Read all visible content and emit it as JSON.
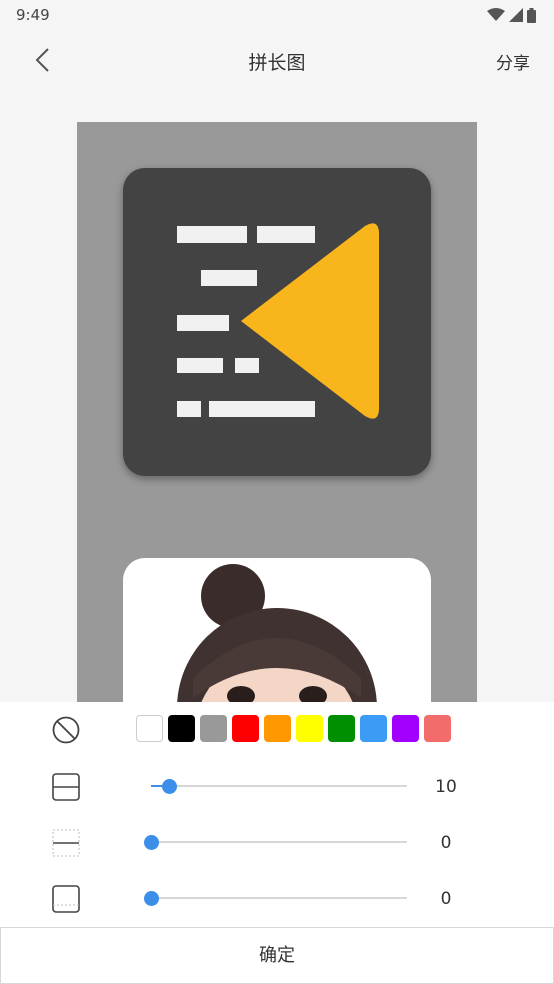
{
  "status_bar": {
    "time": "9:49"
  },
  "header": {
    "title": "拼长图",
    "share_label": "分享"
  },
  "toolbar": {
    "background_colors": [
      "#ffffff",
      "#000000",
      "#999999",
      "#ff0000",
      "#ff9800",
      "#ffff00",
      "#008f00",
      "#3c9bf5",
      "#a100ff",
      "#f26c6c"
    ],
    "controls": [
      {
        "name": "spacing",
        "value": "10",
        "level": 0.07
      },
      {
        "name": "margin-horizontal",
        "value": "0",
        "level": 0.0
      },
      {
        "name": "margin-vertical",
        "value": "0",
        "level": 0.0
      }
    ]
  },
  "footer": {
    "confirm_label": "确定"
  },
  "colors": {
    "accent": "#3c8ee8",
    "preview_background": "#999999"
  },
  "icons": [
    "back-arrow-icon",
    "no-color-icon",
    "spacing-icon",
    "horizontal-margin-icon",
    "vertical-margin-icon",
    "wifi-icon",
    "signal-icon",
    "battery-icon"
  ]
}
